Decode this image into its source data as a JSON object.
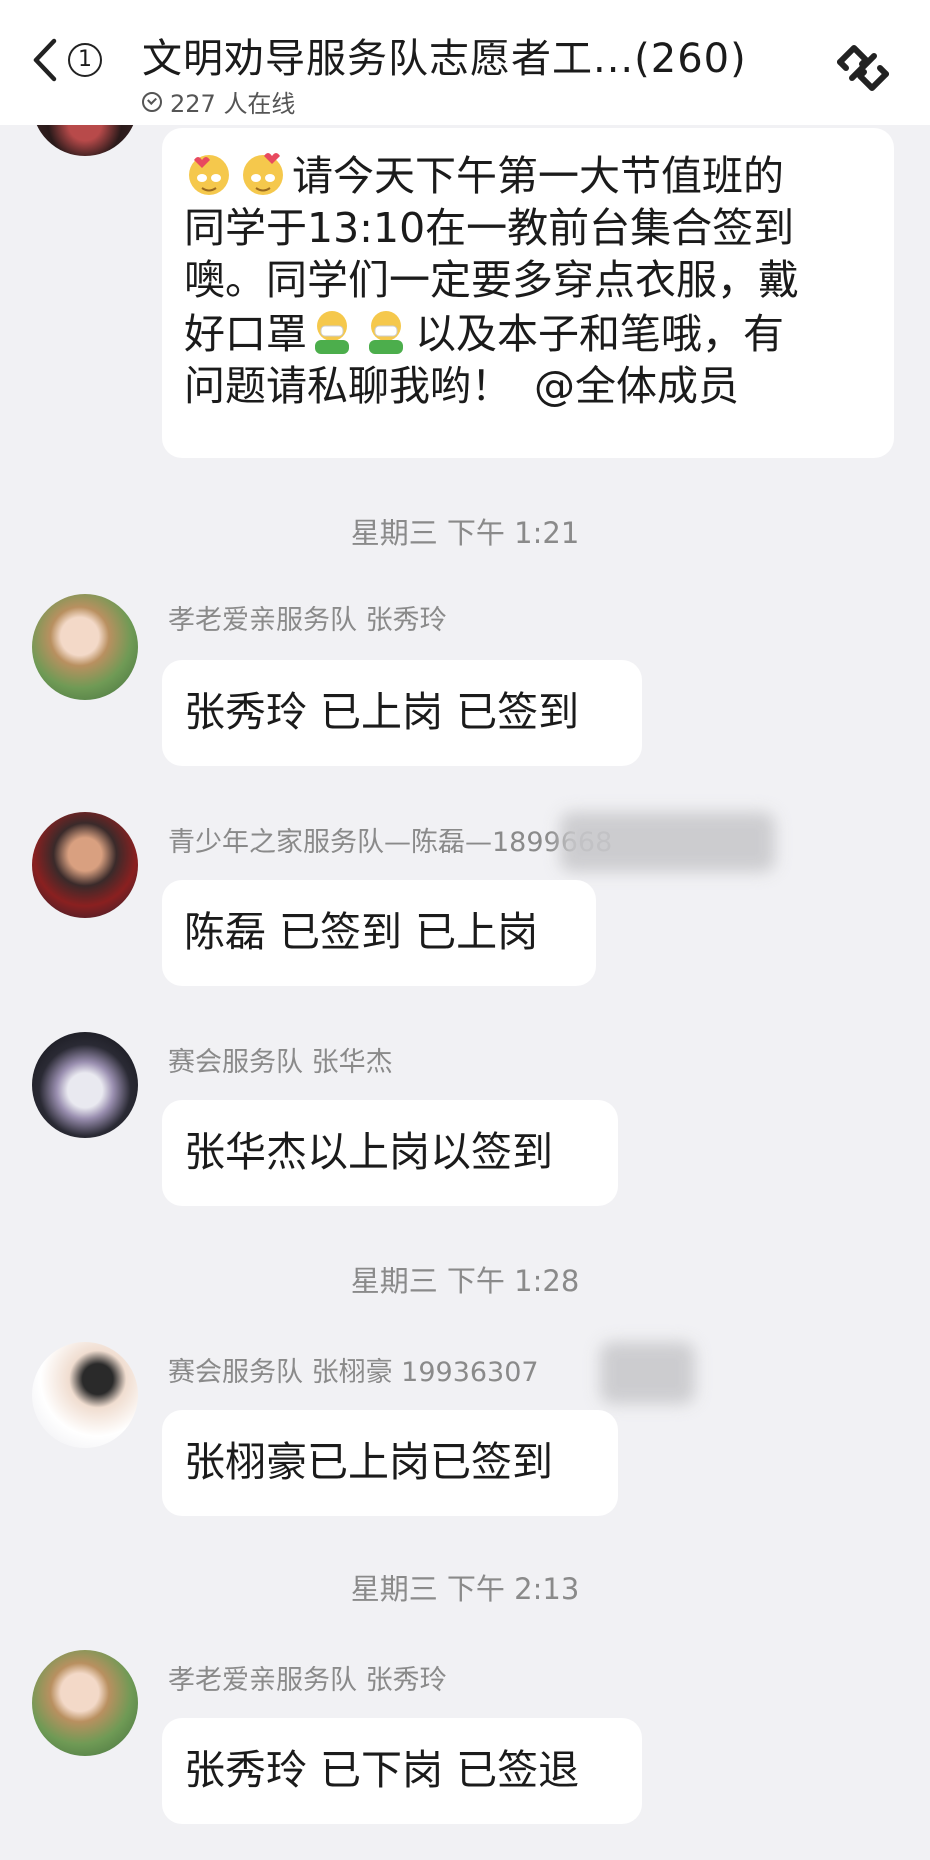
{
  "header": {
    "back_badge": "1",
    "title": "文明劝导服务队志愿者工...(260)",
    "online": "227 人在线"
  },
  "messages": [
    {
      "lines": [
        "请今天下午第一大节值班的",
        "同学于13:10在一教前台集合签到",
        "噢。同学们一定要多穿点衣服，戴",
        "好口罩",
        "以及本子和笔哦，有",
        "问题请私聊我哟！",
        "@全体成员"
      ]
    },
    {
      "timestamp": "星期三 下午 1:21"
    },
    {
      "sender": "孝老爱亲服务队 张秀玲",
      "text": "张秀玲 已上岗 已签到"
    },
    {
      "sender": "青少年之家服务队—陈磊—1899668",
      "text": "陈磊 已签到 已上岗"
    },
    {
      "sender": "赛会服务队   张华杰",
      "text": "张华杰以上岗以签到"
    },
    {
      "timestamp": "星期三 下午 1:28"
    },
    {
      "sender": "赛会服务队   张栩豪 19936307",
      "text": "张栩豪已上岗已签到"
    },
    {
      "timestamp": "星期三 下午 2:13"
    },
    {
      "sender": "孝老爱亲服务队 张秀玲",
      "text": "张秀玲 已下岗 已签退"
    }
  ]
}
